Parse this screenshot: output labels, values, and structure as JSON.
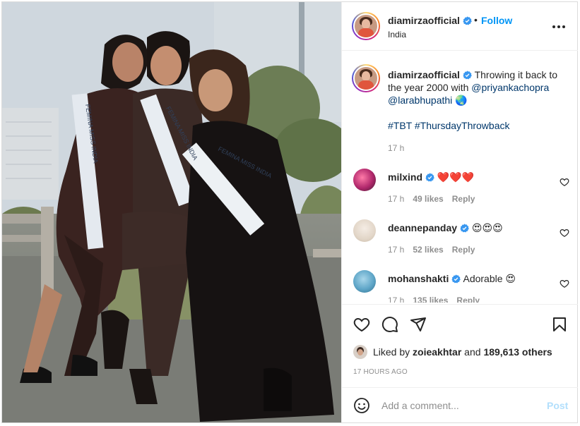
{
  "header": {
    "username": "diamirzaofficial",
    "separator": "•",
    "follow_label": "Follow",
    "location": "India"
  },
  "caption": {
    "username": "diamirzaofficial",
    "text_before": "Throwing it back to the year 2000 with ",
    "mention1": "@priyankachopra",
    "mention2": "@larabhupathi",
    "globe": "🌏",
    "hashtag1": "#TBT",
    "hashtag2": "#ThursdayThrowback",
    "time": "17 h"
  },
  "comments": [
    {
      "username": "milxind",
      "text": "❤️❤️❤️",
      "time": "17 h",
      "likes": "49 likes",
      "reply": "Reply",
      "verified": true
    },
    {
      "username": "deannepanday",
      "text": "😍😍😍",
      "time": "17 h",
      "likes": "52 likes",
      "reply": "Reply",
      "verified": true
    },
    {
      "username": "mohanshakti",
      "text": "Adorable 😍",
      "time": "17 h",
      "likes": "135 likes",
      "reply": "Reply",
      "verified": true
    }
  ],
  "actions": {
    "liked_prefix": "Liked by ",
    "liked_user": "zoieakhtar",
    "liked_mid": " and ",
    "liked_count": "189,613 others",
    "time_ago": "17 HOURS AGO"
  },
  "add_comment": {
    "placeholder": "Add a comment...",
    "post_label": "Post"
  },
  "photo": {
    "sash_text": "FEMINA MISS INDIA"
  },
  "colors": {
    "accent": "#0095f6",
    "link": "#00376b",
    "verified": "#3897f0",
    "muted": "#8e8e8e",
    "post_disabled": "#b2dffc"
  },
  "icons": {
    "header": [
      "verified-icon",
      "more-options-icon"
    ],
    "actions": [
      "like-icon",
      "comment-icon",
      "share-icon",
      "save-icon"
    ],
    "comment": [
      "heart-icon"
    ],
    "input": [
      "emoji-icon"
    ]
  }
}
